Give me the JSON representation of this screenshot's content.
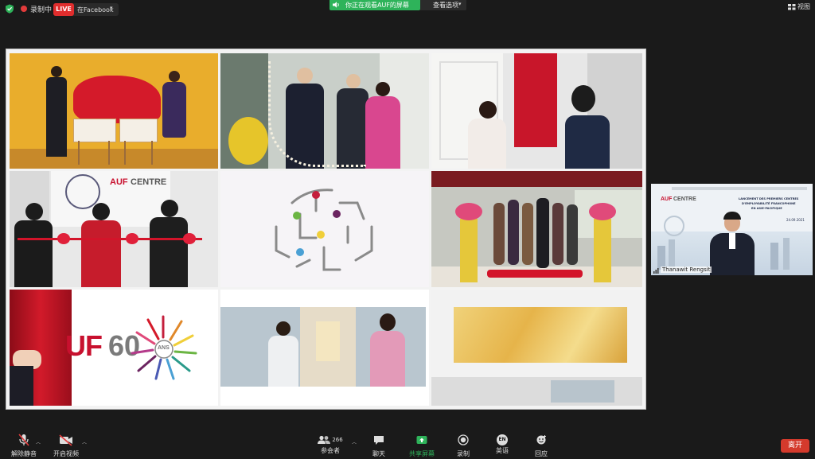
{
  "top_bar": {
    "recording_label": "录制中",
    "live_badge": "LIVE",
    "live_destination": "在Facebook",
    "share_banner": "你正在观看AUF的屏幕",
    "view_options": "查看选项",
    "gallery_view": "视图"
  },
  "shared_screen": {
    "auf_centre_brand": "AUF",
    "auf_centre_word": "CENTRE",
    "auf60_left": "UF",
    "auf60_number": "60",
    "auf60_centre": "ANS"
  },
  "speaker": {
    "name": "Thanawit Rengsit",
    "slide_title_line1": "LANCEMENT DES PREMIERS CENTRES",
    "slide_title_line2": "D'EMPLOYABILITÉ FRANCOPHONE",
    "slide_title_line3": "EN ASIE-PACIFIQUE",
    "slide_date": "24.09.2021",
    "slide_brand": "AUF",
    "slide_brand_word": "CENTRE"
  },
  "toolbar": {
    "unmute": "解除静音",
    "start_video": "开启视频",
    "participants": "参会者",
    "participants_count": "266",
    "chat": "聊天",
    "share_screen": "共享屏幕",
    "record": "录制",
    "interpretation_badge": "EN",
    "interpretation": "英语",
    "reactions": "回应",
    "leave": "离开"
  },
  "colors": {
    "live_red": "#e02d2d",
    "share_green": "#2eb35a",
    "leave_red": "#d43a2c",
    "auf_red": "#c8102e"
  }
}
